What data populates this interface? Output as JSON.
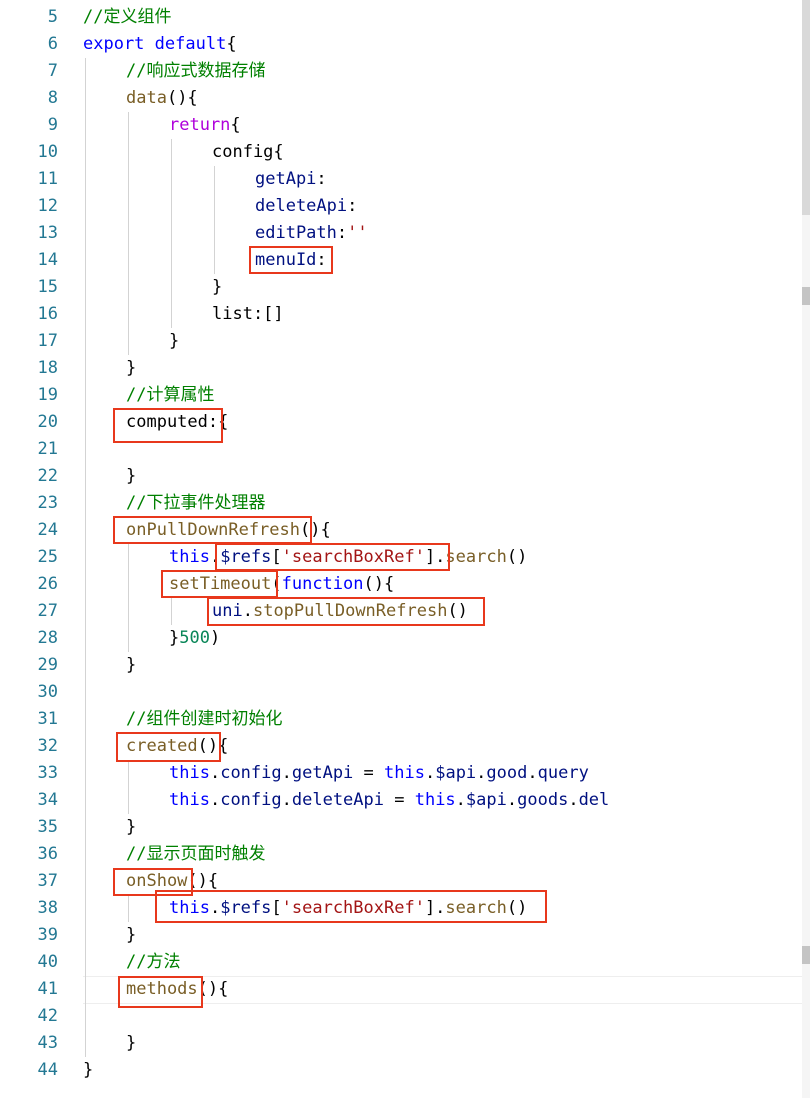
{
  "editor": {
    "lines": [
      {
        "n": "5",
        "indent": 0,
        "tokens": [
          {
            "t": "//定义组件",
            "c": "comment"
          }
        ]
      },
      {
        "n": "6",
        "indent": 0,
        "tokens": [
          {
            "t": "export",
            "c": "keyword"
          },
          {
            "t": " ",
            "c": "plain"
          },
          {
            "t": "default",
            "c": "keyword"
          },
          {
            "t": "{",
            "c": "plain"
          }
        ]
      },
      {
        "n": "7",
        "indent": 1,
        "tokens": [
          {
            "t": "//响应式数据存储",
            "c": "comment"
          }
        ]
      },
      {
        "n": "8",
        "indent": 1,
        "tokens": [
          {
            "t": "data",
            "c": "func"
          },
          {
            "t": "(){",
            "c": "plain"
          }
        ]
      },
      {
        "n": "9",
        "indent": 2,
        "tokens": [
          {
            "t": "return",
            "c": "control"
          },
          {
            "t": "{",
            "c": "plain"
          }
        ]
      },
      {
        "n": "10",
        "indent": 3,
        "tokens": [
          {
            "t": "config{",
            "c": "plain"
          }
        ]
      },
      {
        "n": "11",
        "indent": 4,
        "tokens": [
          {
            "t": "getApi",
            "c": "prop"
          },
          {
            "t": ":",
            "c": "plain"
          }
        ]
      },
      {
        "n": "12",
        "indent": 4,
        "tokens": [
          {
            "t": "deleteApi",
            "c": "prop"
          },
          {
            "t": ":",
            "c": "plain"
          }
        ]
      },
      {
        "n": "13",
        "indent": 4,
        "tokens": [
          {
            "t": "editPath",
            "c": "prop"
          },
          {
            "t": ":",
            "c": "plain"
          },
          {
            "t": "''",
            "c": "string"
          }
        ]
      },
      {
        "n": "14",
        "indent": 4,
        "tokens": [
          {
            "t": "menuId",
            "c": "prop"
          },
          {
            "t": ":",
            "c": "plain"
          }
        ]
      },
      {
        "n": "15",
        "indent": 3,
        "tokens": [
          {
            "t": "}",
            "c": "plain"
          }
        ]
      },
      {
        "n": "16",
        "indent": 3,
        "tokens": [
          {
            "t": "list:[]",
            "c": "plain"
          }
        ]
      },
      {
        "n": "17",
        "indent": 2,
        "tokens": [
          {
            "t": "}",
            "c": "plain"
          }
        ]
      },
      {
        "n": "18",
        "indent": 1,
        "tokens": [
          {
            "t": "}",
            "c": "plain"
          }
        ]
      },
      {
        "n": "19",
        "indent": 1,
        "tokens": [
          {
            "t": "//计算属性",
            "c": "comment"
          }
        ]
      },
      {
        "n": "20",
        "indent": 1,
        "tokens": [
          {
            "t": "computed",
            "c": "plain"
          },
          {
            "t": ":{",
            "c": "plain"
          }
        ]
      },
      {
        "n": "21",
        "indent": 1,
        "tokens": []
      },
      {
        "n": "22",
        "indent": 1,
        "tokens": [
          {
            "t": "}",
            "c": "plain"
          }
        ]
      },
      {
        "n": "23",
        "indent": 1,
        "tokens": [
          {
            "t": "//下拉事件处理器",
            "c": "comment"
          }
        ]
      },
      {
        "n": "24",
        "indent": 1,
        "tokens": [
          {
            "t": "onPullDownRefresh",
            "c": "func"
          },
          {
            "t": "(){",
            "c": "plain"
          }
        ]
      },
      {
        "n": "25",
        "indent": 2,
        "tokens": [
          {
            "t": "this",
            "c": "this"
          },
          {
            "t": ".",
            "c": "plain"
          },
          {
            "t": "$refs",
            "c": "prop"
          },
          {
            "t": "[",
            "c": "plain"
          },
          {
            "t": "'searchBoxRef'",
            "c": "string"
          },
          {
            "t": "].",
            "c": "plain"
          },
          {
            "t": "search",
            "c": "func"
          },
          {
            "t": "()",
            "c": "plain"
          }
        ]
      },
      {
        "n": "26",
        "indent": 2,
        "tokens": [
          {
            "t": "setTimeout",
            "c": "func"
          },
          {
            "t": "(",
            "c": "plain"
          },
          {
            "t": "function",
            "c": "keyword"
          },
          {
            "t": "(){",
            "c": "plain"
          }
        ]
      },
      {
        "n": "27",
        "indent": 3,
        "tokens": [
          {
            "t": "uni",
            "c": "class"
          },
          {
            "t": ".",
            "c": "plain"
          },
          {
            "t": "stopPullDownRefresh",
            "c": "func"
          },
          {
            "t": "()",
            "c": "plain"
          }
        ]
      },
      {
        "n": "28",
        "indent": 2,
        "tokens": [
          {
            "t": "}",
            "c": "plain"
          },
          {
            "t": "500",
            "c": "number"
          },
          {
            "t": ")",
            "c": "plain"
          }
        ]
      },
      {
        "n": "29",
        "indent": 1,
        "tokens": [
          {
            "t": "}",
            "c": "plain"
          }
        ]
      },
      {
        "n": "30",
        "indent": 1,
        "tokens": []
      },
      {
        "n": "31",
        "indent": 1,
        "tokens": [
          {
            "t": "//组件创建时初始化",
            "c": "comment"
          }
        ]
      },
      {
        "n": "32",
        "indent": 1,
        "tokens": [
          {
            "t": "created",
            "c": "func"
          },
          {
            "t": "(){",
            "c": "plain"
          }
        ]
      },
      {
        "n": "33",
        "indent": 2,
        "tokens": [
          {
            "t": "this",
            "c": "this"
          },
          {
            "t": ".",
            "c": "plain"
          },
          {
            "t": "config",
            "c": "prop"
          },
          {
            "t": ".",
            "c": "plain"
          },
          {
            "t": "getApi",
            "c": "prop"
          },
          {
            "t": " = ",
            "c": "plain"
          },
          {
            "t": "this",
            "c": "this"
          },
          {
            "t": ".",
            "c": "plain"
          },
          {
            "t": "$api",
            "c": "prop"
          },
          {
            "t": ".",
            "c": "plain"
          },
          {
            "t": "good",
            "c": "prop"
          },
          {
            "t": ".",
            "c": "plain"
          },
          {
            "t": "query",
            "c": "prop"
          }
        ]
      },
      {
        "n": "34",
        "indent": 2,
        "tokens": [
          {
            "t": "this",
            "c": "this"
          },
          {
            "t": ".",
            "c": "plain"
          },
          {
            "t": "config",
            "c": "prop"
          },
          {
            "t": ".",
            "c": "plain"
          },
          {
            "t": "deleteApi",
            "c": "prop"
          },
          {
            "t": " = ",
            "c": "plain"
          },
          {
            "t": "this",
            "c": "this"
          },
          {
            "t": ".",
            "c": "plain"
          },
          {
            "t": "$api",
            "c": "prop"
          },
          {
            "t": ".",
            "c": "plain"
          },
          {
            "t": "goods",
            "c": "prop"
          },
          {
            "t": ".",
            "c": "plain"
          },
          {
            "t": "del",
            "c": "prop"
          }
        ]
      },
      {
        "n": "35",
        "indent": 1,
        "tokens": [
          {
            "t": "}",
            "c": "plain"
          }
        ]
      },
      {
        "n": "36",
        "indent": 1,
        "tokens": [
          {
            "t": "//显示页面时触发",
            "c": "comment"
          }
        ]
      },
      {
        "n": "37",
        "indent": 1,
        "tokens": [
          {
            "t": "onShow",
            "c": "func"
          },
          {
            "t": "(){",
            "c": "plain"
          }
        ]
      },
      {
        "n": "38",
        "indent": 2,
        "tokens": [
          {
            "t": "this",
            "c": "this"
          },
          {
            "t": ".",
            "c": "plain"
          },
          {
            "t": "$refs",
            "c": "prop"
          },
          {
            "t": "[",
            "c": "plain"
          },
          {
            "t": "'searchBoxRef'",
            "c": "string"
          },
          {
            "t": "].",
            "c": "plain"
          },
          {
            "t": "search",
            "c": "func"
          },
          {
            "t": "()",
            "c": "plain"
          }
        ]
      },
      {
        "n": "39",
        "indent": 1,
        "tokens": [
          {
            "t": "}",
            "c": "plain"
          }
        ]
      },
      {
        "n": "40",
        "indent": 1,
        "tokens": [
          {
            "t": "//方法",
            "c": "comment"
          }
        ]
      },
      {
        "n": "41",
        "indent": 1,
        "tokens": [
          {
            "t": "methods",
            "c": "func"
          },
          {
            "t": "(){",
            "c": "plain"
          }
        ]
      },
      {
        "n": "42",
        "indent": 1,
        "tokens": []
      },
      {
        "n": "43",
        "indent": 1,
        "tokens": [
          {
            "t": "}",
            "c": "plain"
          }
        ]
      },
      {
        "n": "44",
        "indent": 0,
        "tokens": [
          {
            "t": "}",
            "c": "plain"
          }
        ]
      }
    ],
    "current_line": "41"
  },
  "highlight_color": "#e8381c"
}
